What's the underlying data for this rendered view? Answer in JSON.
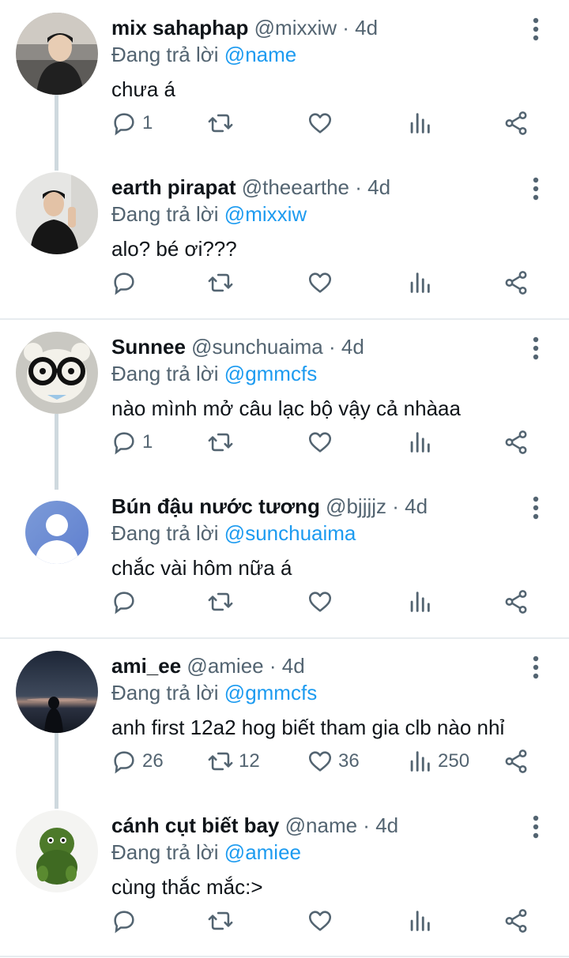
{
  "reply_prefix": "Đang trả lời",
  "dot": "·",
  "tweets": [
    {
      "name": "mix sahaphap",
      "handle": "@mixxiw",
      "time": "4d",
      "reply_to": "@name",
      "text": "chưa á",
      "replies": "1",
      "retweets": "",
      "likes": "",
      "views": ""
    },
    {
      "name": "earth pirapat",
      "handle": "@theearthe",
      "time": "4d",
      "reply_to": "@mixxiw",
      "text": "alo? bé ơi???",
      "replies": "",
      "retweets": "",
      "likes": "",
      "views": ""
    },
    {
      "name": "Sunnee",
      "handle": "@sunchuaima",
      "time": "4d",
      "reply_to": "@gmmcfs",
      "text": "nào mình mở câu lạc bộ vậy cả nhàaa",
      "replies": "1",
      "retweets": "",
      "likes": "",
      "views": ""
    },
    {
      "name": "Bún đậu nước tương",
      "handle": "@bjjjjz",
      "time": "4d",
      "reply_to": "@sunchuaima",
      "text": "chắc vài hôm nữa á",
      "replies": "",
      "retweets": "",
      "likes": "",
      "views": ""
    },
    {
      "name": "ami_ee",
      "handle": "@amiee",
      "time": "4d",
      "reply_to": "@gmmcfs",
      "text": "anh first 12a2 hog biết tham gia clb nào nhỉ",
      "replies": "26",
      "retweets": "12",
      "likes": "36",
      "views": "250"
    },
    {
      "name": "cánh cụt biết bay",
      "handle": "@name",
      "time": "4d",
      "reply_to": "@amiee",
      "text": "cùng thắc mắc:>",
      "replies": "",
      "retweets": "",
      "likes": "",
      "views": ""
    }
  ],
  "icons": {
    "reply": "reply-icon",
    "retweet": "retweet-icon",
    "like": "heart-icon",
    "views": "views-icon",
    "share": "share-icon",
    "more": "more-vertical-icon"
  },
  "colors": {
    "link": "#1d9bf0",
    "muted": "#536471",
    "text": "#0f1419",
    "divider": "#e7ecef",
    "thread": "#cfd9de"
  }
}
